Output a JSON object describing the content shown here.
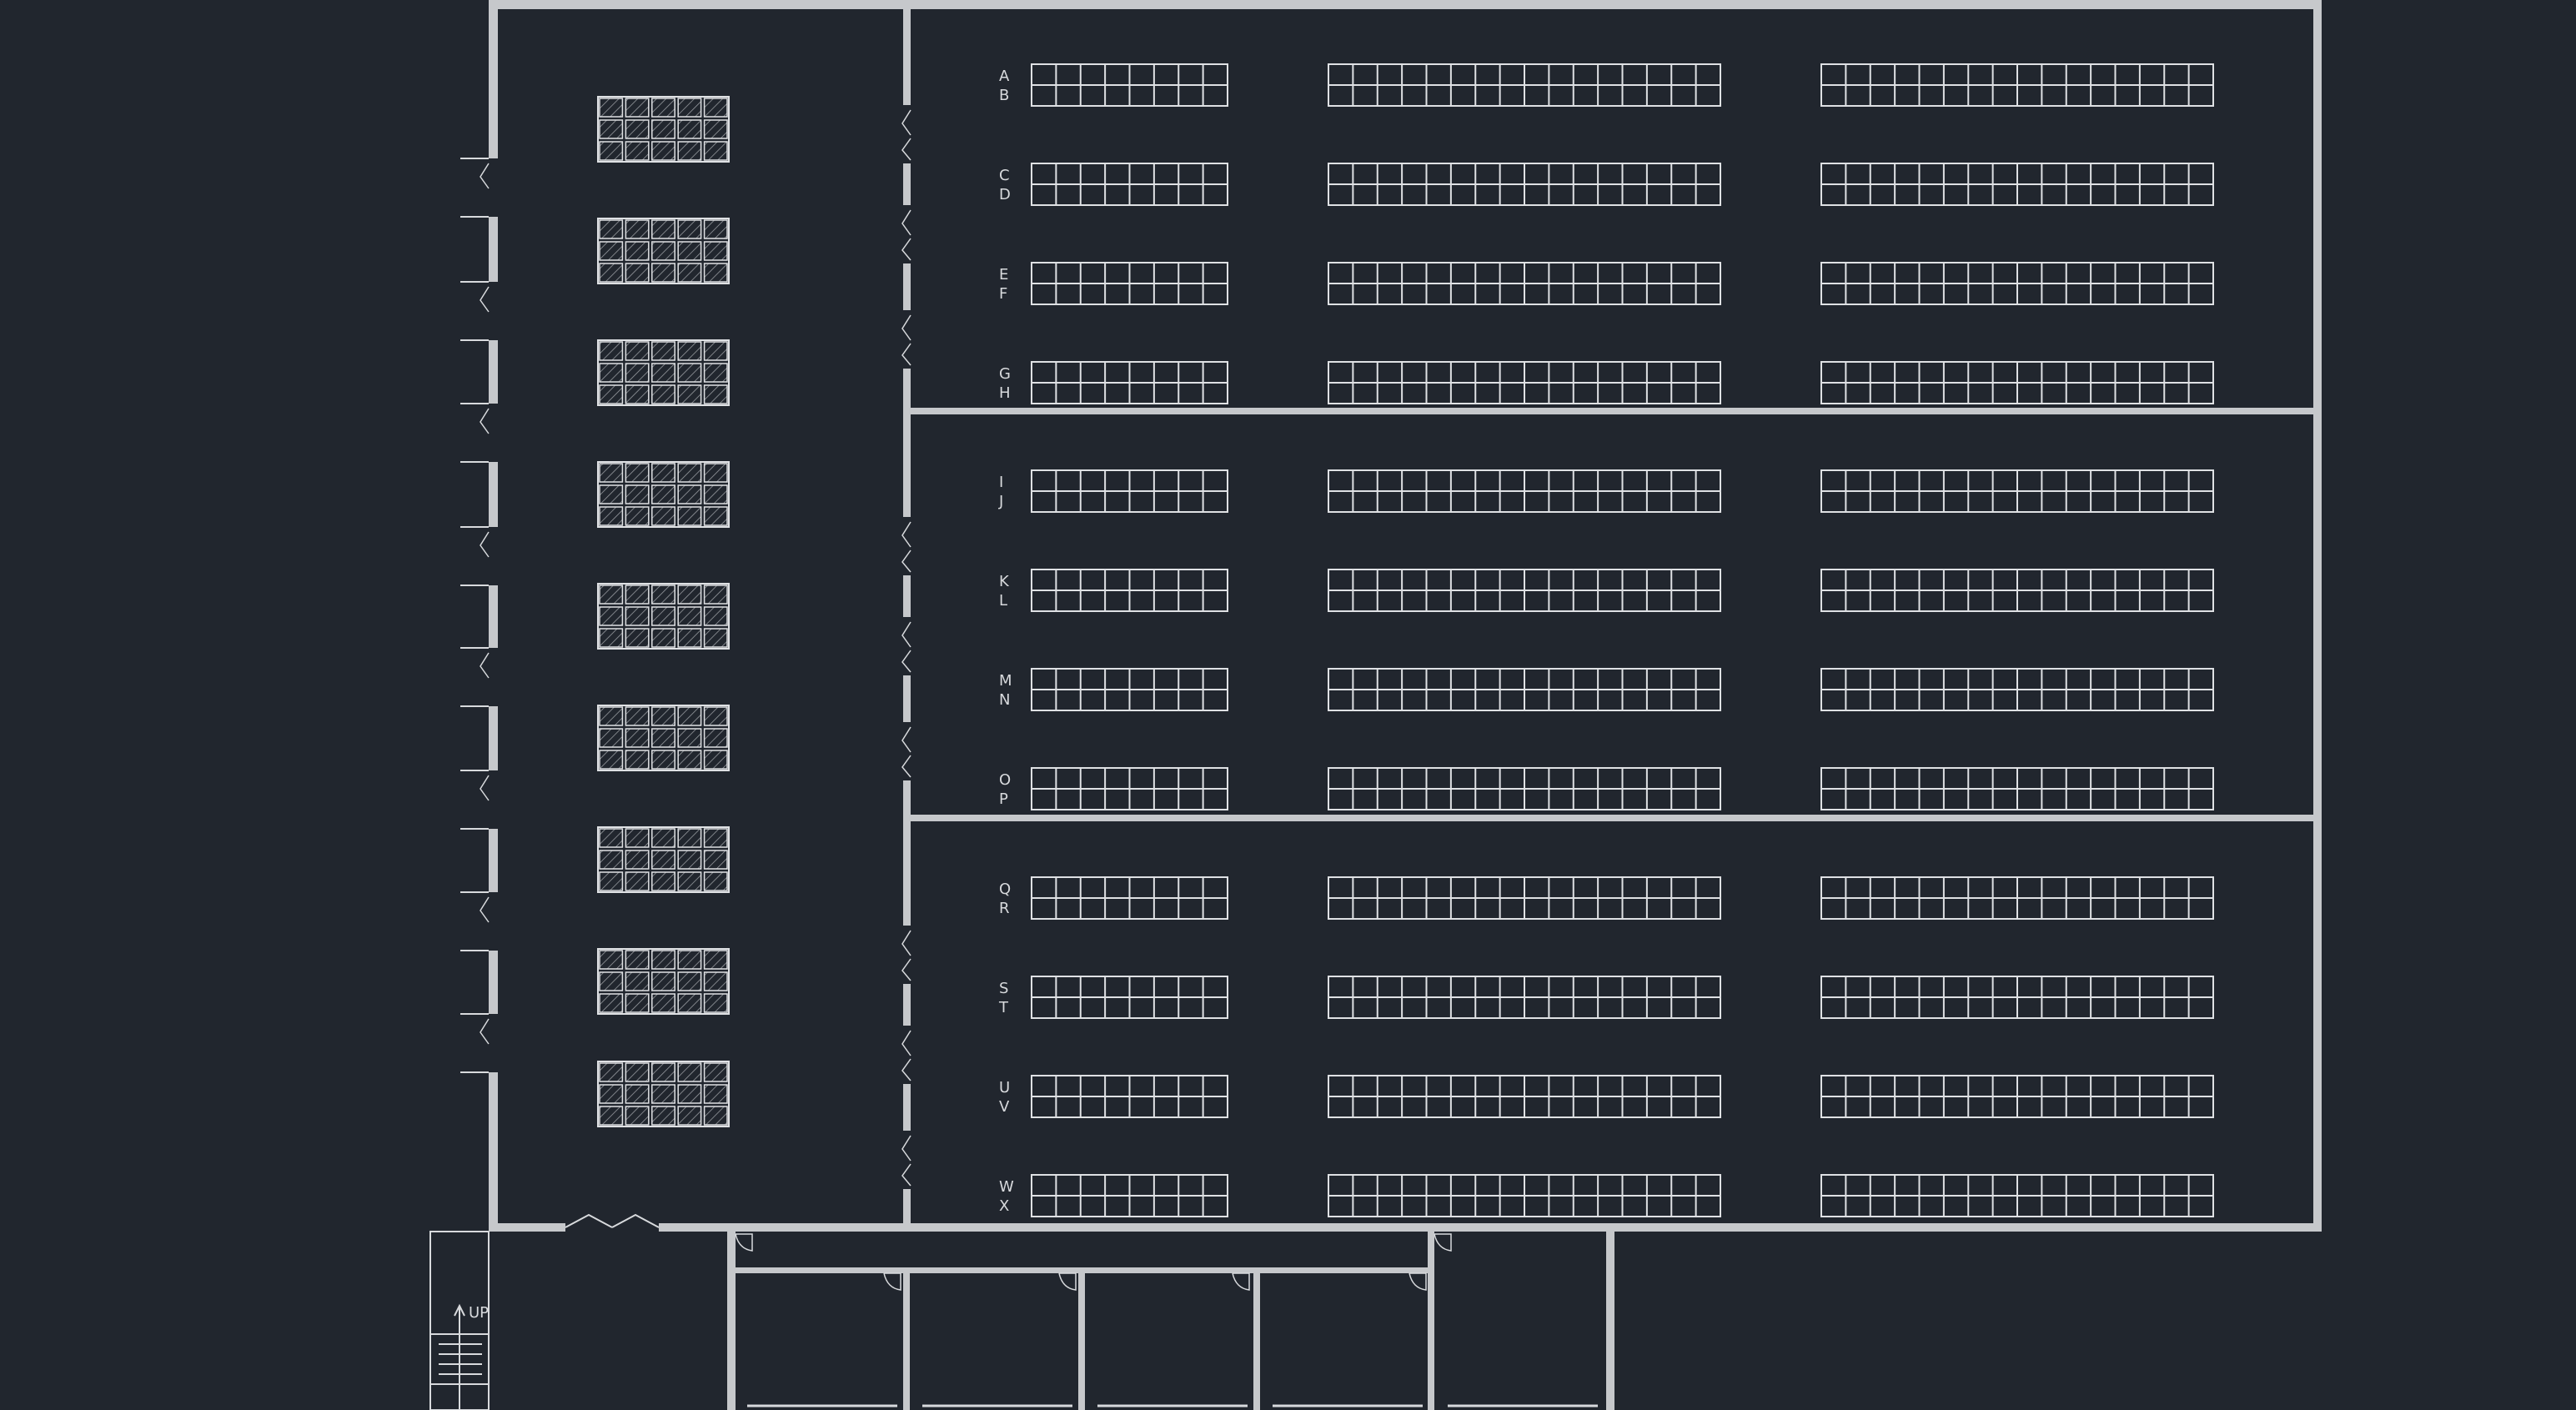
{
  "drawing": {
    "background": "#21262e",
    "line_color": "#d8dadd",
    "wall_color": "#c6c8cb",
    "stair_label": "UP",
    "arrow_icon": "up-arrow-icon"
  },
  "aisles": [
    {
      "top": "A",
      "bottom": "B"
    },
    {
      "top": "C",
      "bottom": "D"
    },
    {
      "top": "E",
      "bottom": "F"
    },
    {
      "top": "G",
      "bottom": "H"
    },
    {
      "top": "I",
      "bottom": "J"
    },
    {
      "top": "K",
      "bottom": "L"
    },
    {
      "top": "M",
      "bottom": "N"
    },
    {
      "top": "O",
      "bottom": "P"
    },
    {
      "top": "Q",
      "bottom": "R"
    },
    {
      "top": "S",
      "bottom": "T"
    },
    {
      "top": "U",
      "bottom": "V"
    },
    {
      "top": "W",
      "bottom": "X"
    }
  ]
}
